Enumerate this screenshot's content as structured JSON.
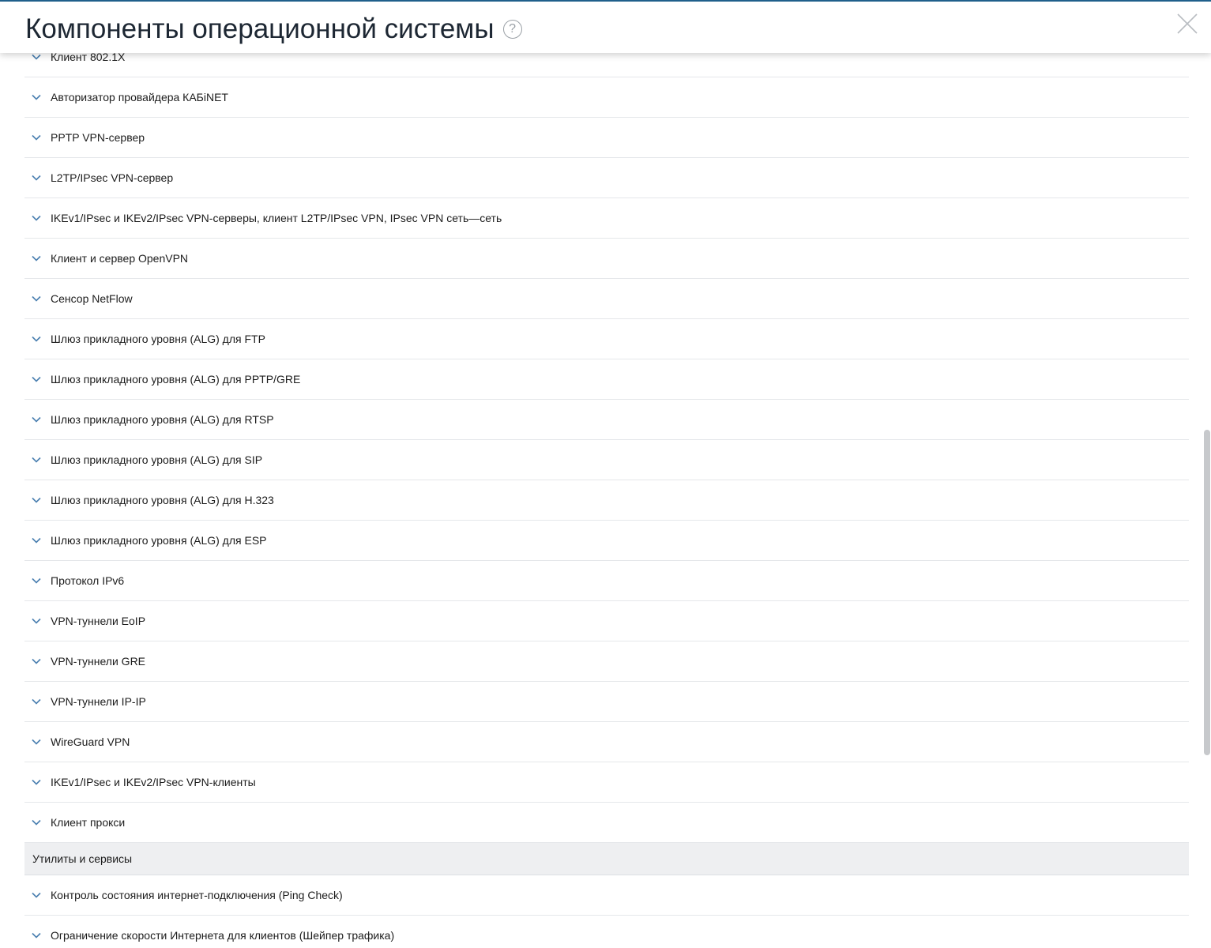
{
  "header": {
    "title": "Компоненты операционной системы",
    "help_icon_glyph": "?"
  },
  "icons": {
    "help": "question-circle-icon",
    "close": "close-icon",
    "expand": "chevron-down-icon"
  },
  "colors": {
    "accent_line": "#1f5f8b",
    "chevron": "#4a7fb0",
    "section_bg": "#eeeff1",
    "divider": "#e5e7ea"
  },
  "list": {
    "partial_top_item": "Клиент 802.1X",
    "items": [
      "Авторизатор провайдера КАБiNET",
      "PPTP VPN-сервер",
      "L2TP/IPsec VPN-сервер",
      "IKEv1/IPsec и IKEv2/IPsec VPN-серверы, клиент L2TP/IPsec VPN, IPsec VPN сеть—сеть",
      "Клиент и сервер OpenVPN",
      "Сенсор NetFlow",
      "Шлюз прикладного уровня (ALG) для FTP",
      "Шлюз прикладного уровня (ALG) для PPTP/GRE",
      "Шлюз прикладного уровня (ALG) для RTSP",
      "Шлюз прикладного уровня (ALG) для SIP",
      "Шлюз прикладного уровня (ALG) для H.323",
      "Шлюз прикладного уровня (ALG) для ESP",
      "Протокол IPv6",
      "VPN-туннели EoIP",
      "VPN-туннели GRE",
      "VPN-туннели IP-IP",
      "WireGuard VPN",
      "IKEv1/IPsec и IKEv2/IPsec VPN-клиенты",
      "Клиент прокси"
    ],
    "section_title": "Утилиты и сервисы",
    "section_items": [
      "Контроль состояния интернет-подключения (Ping Check)",
      "Ограничение скорости Интернета для клиентов (Шейпер трафика)"
    ]
  }
}
